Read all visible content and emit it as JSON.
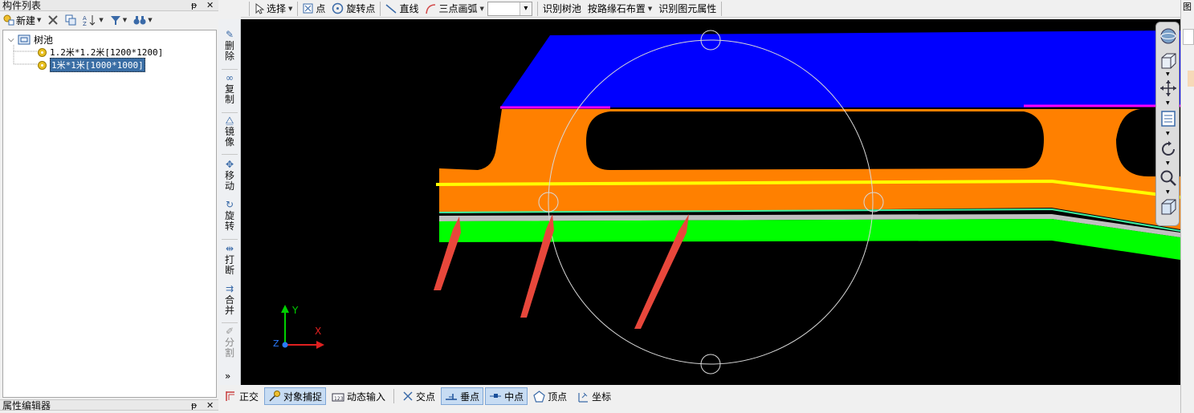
{
  "left_panel": {
    "component_list_title": "构件列表",
    "pin_glyph": "ᵽ",
    "close_glyph": "✕",
    "toolbar": {
      "new_label": "新建",
      "filter_icon": "filter-icon",
      "binoculars_icon": "binoculars-icon"
    },
    "tree": {
      "root": {
        "label": "树池",
        "expanded": true
      },
      "children": [
        {
          "label": "1.2米*1.2米[1200*1200]",
          "selected": false
        },
        {
          "label": "1米*1米[1000*1000]",
          "selected": true
        }
      ]
    },
    "property_editor_title": "属性编辑器"
  },
  "vertical_toolbar": {
    "expand_glyph": "»",
    "items": [
      {
        "id": "delete",
        "label": "删除"
      },
      {
        "id": "copy",
        "label": "复制"
      },
      {
        "id": "mirror",
        "label": "镜像"
      },
      {
        "id": "move",
        "label": "移动"
      },
      {
        "id": "rotate",
        "label": "旋转"
      },
      {
        "id": "break",
        "label": "打断"
      },
      {
        "id": "merge",
        "label": "合并"
      },
      {
        "id": "split",
        "label": "分割"
      }
    ]
  },
  "top_toolbar": {
    "select_label": "选择",
    "point_label": "点",
    "rotate_point_label": "旋转点",
    "line_label": "直线",
    "arc_label": "三点画弧",
    "arc_combo_value": "",
    "identify_tree_pool_label": "识别树池",
    "curb_layout_label": "按路缘石布置",
    "identify_attr_label": "识别图元属性"
  },
  "canvas": {
    "axis_x_label": "X",
    "axis_y_label": "Y",
    "axis_z_label": "Z",
    "colors": {
      "background": "#000000",
      "blue_band": "#0000ff",
      "orange_band": "#ff8000",
      "yellow_line": "#ffff00",
      "green_band": "#00ff00",
      "grey_line": "#c0c0c0",
      "arrow": "#e8473b",
      "circle": "#d8d8d8"
    }
  },
  "status_bar": {
    "ortho_label": "正交",
    "snap_label": "对象捕捉",
    "dynamic_input_label": "动态输入",
    "intersection_label": "交点",
    "perpendicular_label": "垂点",
    "midpoint_label": "中点",
    "vertex_label": "顶点",
    "coordinate_label": "坐标"
  },
  "right_strip": {
    "title_fragment": "图"
  }
}
